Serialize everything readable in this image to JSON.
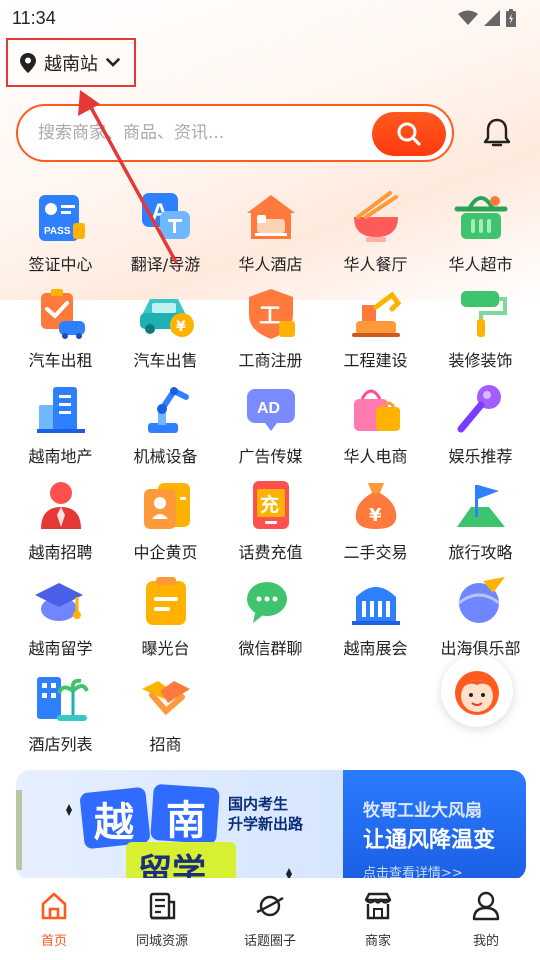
{
  "status": {
    "time": "11:34"
  },
  "header": {
    "location": "越南站",
    "search_placeholder": "搜索商家、商品、资讯..."
  },
  "grid": [
    {
      "label": "签证中心",
      "icon": "passport-icon"
    },
    {
      "label": "翻译/导游",
      "icon": "translate-icon"
    },
    {
      "label": "华人酒店",
      "icon": "hotel-icon"
    },
    {
      "label": "华人餐厅",
      "icon": "restaurant-icon"
    },
    {
      "label": "华人超市",
      "icon": "supermarket-icon"
    },
    {
      "label": "汽车出租",
      "icon": "car-rental-icon"
    },
    {
      "label": "汽车出售",
      "icon": "car-sale-icon"
    },
    {
      "label": "工商注册",
      "icon": "business-registration-icon"
    },
    {
      "label": "工程建设",
      "icon": "construction-icon"
    },
    {
      "label": "装修装饰",
      "icon": "paint-roller-icon"
    },
    {
      "label": "越南地产",
      "icon": "real-estate-icon"
    },
    {
      "label": "机械设备",
      "icon": "machinery-icon"
    },
    {
      "label": "广告传媒",
      "icon": "ad-media-icon"
    },
    {
      "label": "华人电商",
      "icon": "shopping-bag-icon"
    },
    {
      "label": "娱乐推荐",
      "icon": "microphone-icon"
    },
    {
      "label": "越南招聘",
      "icon": "recruit-icon"
    },
    {
      "label": "中企黄页",
      "icon": "yellow-pages-icon"
    },
    {
      "label": "话费充值",
      "icon": "topup-icon"
    },
    {
      "label": "二手交易",
      "icon": "money-bag-icon"
    },
    {
      "label": "旅行攻略",
      "icon": "travel-flag-icon"
    },
    {
      "label": "越南留学",
      "icon": "graduation-cap-icon"
    },
    {
      "label": "曝光台",
      "icon": "clipboard-icon"
    },
    {
      "label": "微信群聊",
      "icon": "wechat-icon"
    },
    {
      "label": "越南展会",
      "icon": "exhibition-icon"
    },
    {
      "label": "出海俱乐部",
      "icon": "globe-plane-icon"
    },
    {
      "label": "酒店列表",
      "icon": "hotel-list-icon"
    },
    {
      "label": "招商",
      "icon": "handshake-icon"
    }
  ],
  "banner": {
    "left": {
      "char1": "越",
      "char2": "南",
      "char3": "留学",
      "line1": "国内考生",
      "line2": "升学新出路"
    },
    "right": {
      "title": "牧哥工业大风扇",
      "subtitle": "让通风降温变",
      "link": "点击查看详情>>"
    }
  },
  "tabs": [
    {
      "label": "首页",
      "icon": "home-icon",
      "active": true
    },
    {
      "label": "同城资源",
      "icon": "resources-icon",
      "active": false
    },
    {
      "label": "话题圈子",
      "icon": "planet-icon",
      "active": false
    },
    {
      "label": "商家",
      "icon": "store-icon",
      "active": false
    },
    {
      "label": "我的",
      "icon": "user-icon",
      "active": false
    }
  ],
  "colors": {
    "accent": "#ff5a1f",
    "annotation": "#e53935"
  }
}
